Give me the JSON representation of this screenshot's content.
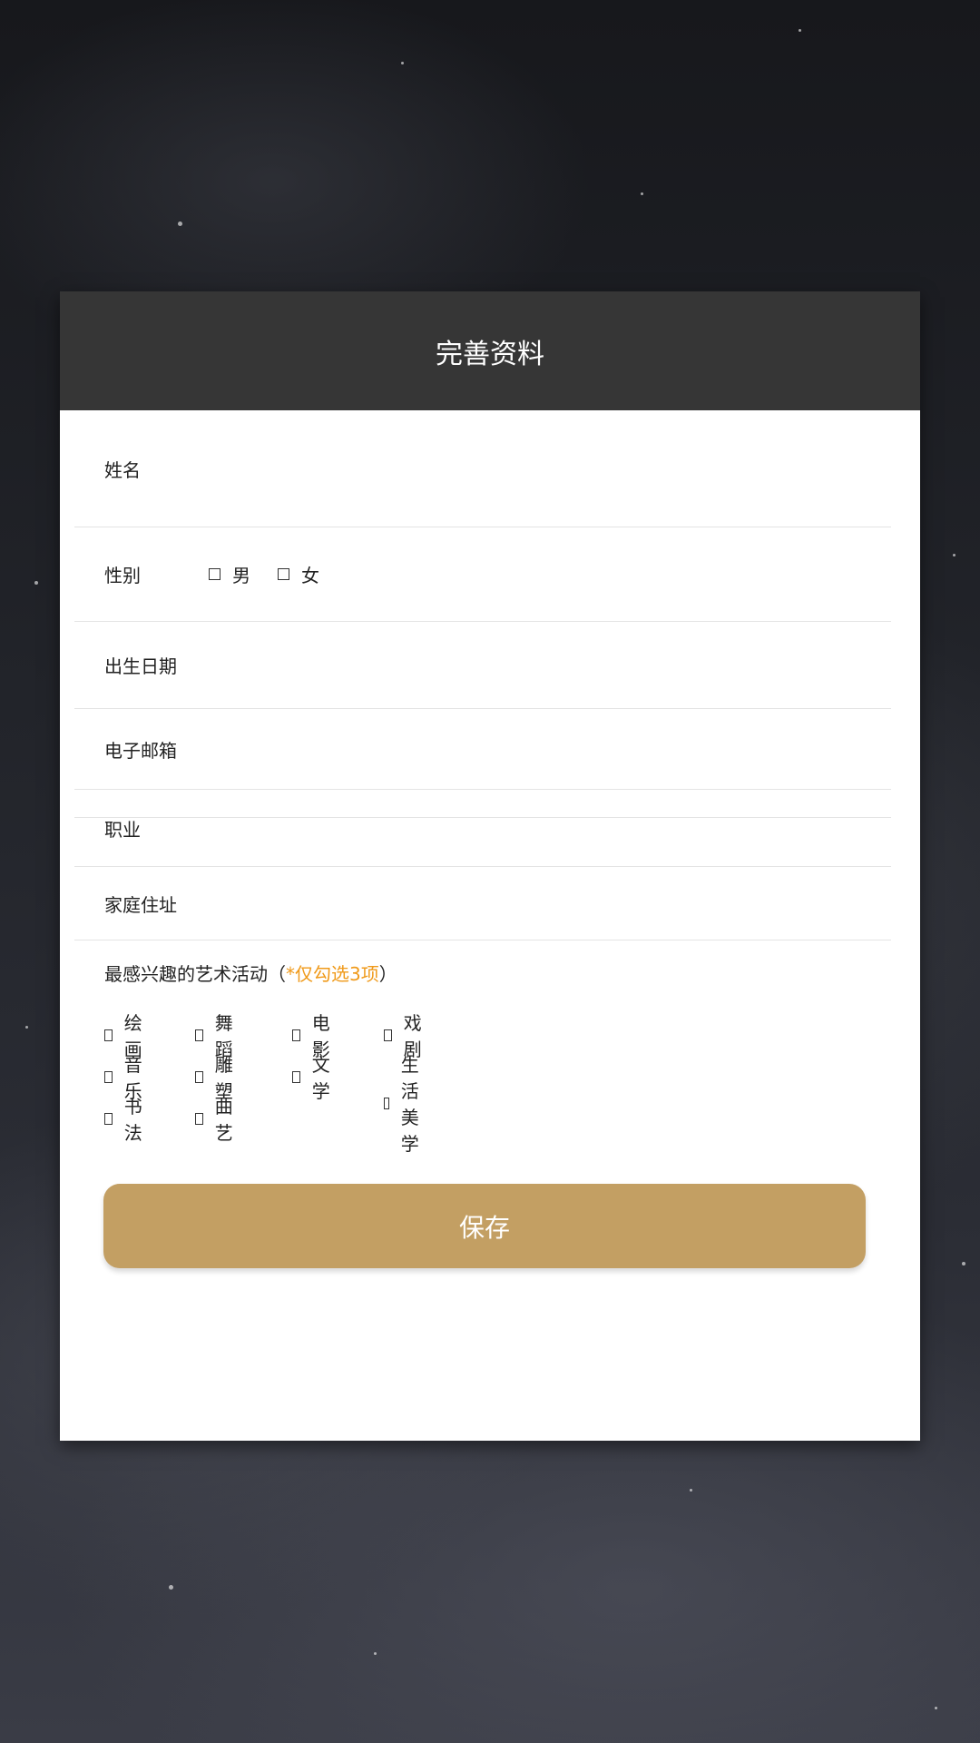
{
  "form": {
    "title": "完善资料",
    "name_label": "姓名",
    "gender_label": "性别",
    "gender_options": [
      "男",
      "女"
    ],
    "birthdate_label": "出生日期",
    "email_label": "电子邮箱",
    "occupation_label": "职业",
    "address_label": "家庭住址",
    "interests": {
      "title": "最感兴趣的艺术活动（",
      "note": "*仅勾选3项",
      "close": "）",
      "options": [
        "绘画",
        "舞蹈",
        "电影",
        "戏剧",
        "音乐",
        "雕塑",
        "文学",
        "生活美学",
        "书法",
        "曲艺"
      ]
    },
    "save_label": "保存"
  },
  "colors": {
    "header_bg": "#363636",
    "accent_button": "#c39f63",
    "note_orange": "#f09a1a"
  }
}
